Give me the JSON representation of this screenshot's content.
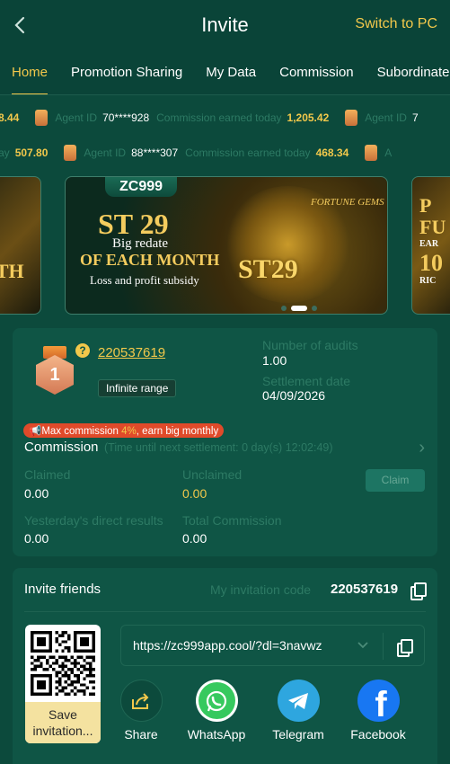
{
  "header": {
    "back_icon": "chevron-left-icon",
    "title": "Invite",
    "switch_label": "Switch to PC"
  },
  "tabs": [
    {
      "label": "Home",
      "active": true
    },
    {
      "label": "Promotion Sharing",
      "active": false
    },
    {
      "label": "My Data",
      "active": false
    },
    {
      "label": "Commission",
      "active": false
    },
    {
      "label": "Subordinate",
      "active": false
    }
  ],
  "ticker": {
    "row1": [
      {
        "value": "8.44"
      },
      {
        "label": "Agent ID",
        "id": "70****928",
        "earned_label": "Commission earned today",
        "value": "1,205.42"
      },
      {
        "label": "Agent ID",
        "id": "7"
      }
    ],
    "row2": [
      {
        "earned_label": "ay",
        "value": "507.80"
      },
      {
        "label": "Agent ID",
        "id": "88****307",
        "earned_label": "Commission earned today",
        "value": "468.34"
      },
      {
        "label": "A"
      }
    ]
  },
  "banner": {
    "brand": "ZC999",
    "headline": "ST 29",
    "line1": "Big redate",
    "line2": "OF EACH MONTH",
    "line3": "Loss and profit subsidy",
    "art_text": "ST29",
    "art_caption": "FORTUNE GEMS",
    "left_slide_text": "NTH",
    "right_slide_line1": "P",
    "right_slide_line2": "FU",
    "right_slide_line3": "EAR",
    "right_slide_line4": "10",
    "right_slide_line5": "RIC",
    "slide_count": 3,
    "active_slide": 1
  },
  "agent": {
    "level": "1",
    "id": "220537619",
    "range_tag": "Infinite range",
    "audits_label": "Number of audits",
    "audits_value": "1.00",
    "settlement_label": "Settlement date",
    "settlement_value": "04/09/2026"
  },
  "commission": {
    "promo_prefix": "Max commission ",
    "promo_pct": "4%",
    "promo_suffix": ", earn big monthly",
    "title": "Commission",
    "note": "(Time until next settlement: 0 day(s) 12:02:49)",
    "claimed_label": "Claimed",
    "claimed_value": "0.00",
    "unclaimed_label": "Unclaimed",
    "unclaimed_value": "0.00",
    "claim_button": "Claim",
    "yesterday_label": "Yesterday's direct results",
    "yesterday_value": "0.00",
    "total_label": "Total Commission",
    "total_value": "0.00"
  },
  "invite": {
    "title": "Invite friends",
    "code_label": "My invitation code",
    "code_value": "220537619",
    "link": "https://zc999app.cool/?dl=3navwz",
    "save_button": "Save invitation..."
  },
  "share": [
    {
      "label": "Share",
      "icon": "share-icon"
    },
    {
      "label": "WhatsApp",
      "icon": "whatsapp-icon"
    },
    {
      "label": "Telegram",
      "icon": "telegram-icon"
    },
    {
      "label": "Facebook",
      "icon": "facebook-icon"
    }
  ],
  "colors": {
    "background": "#0c4a3c",
    "card": "#0f5545",
    "accent": "#f2c84b",
    "muted": "#2d7a64",
    "promo_red": "#e04a2a"
  }
}
